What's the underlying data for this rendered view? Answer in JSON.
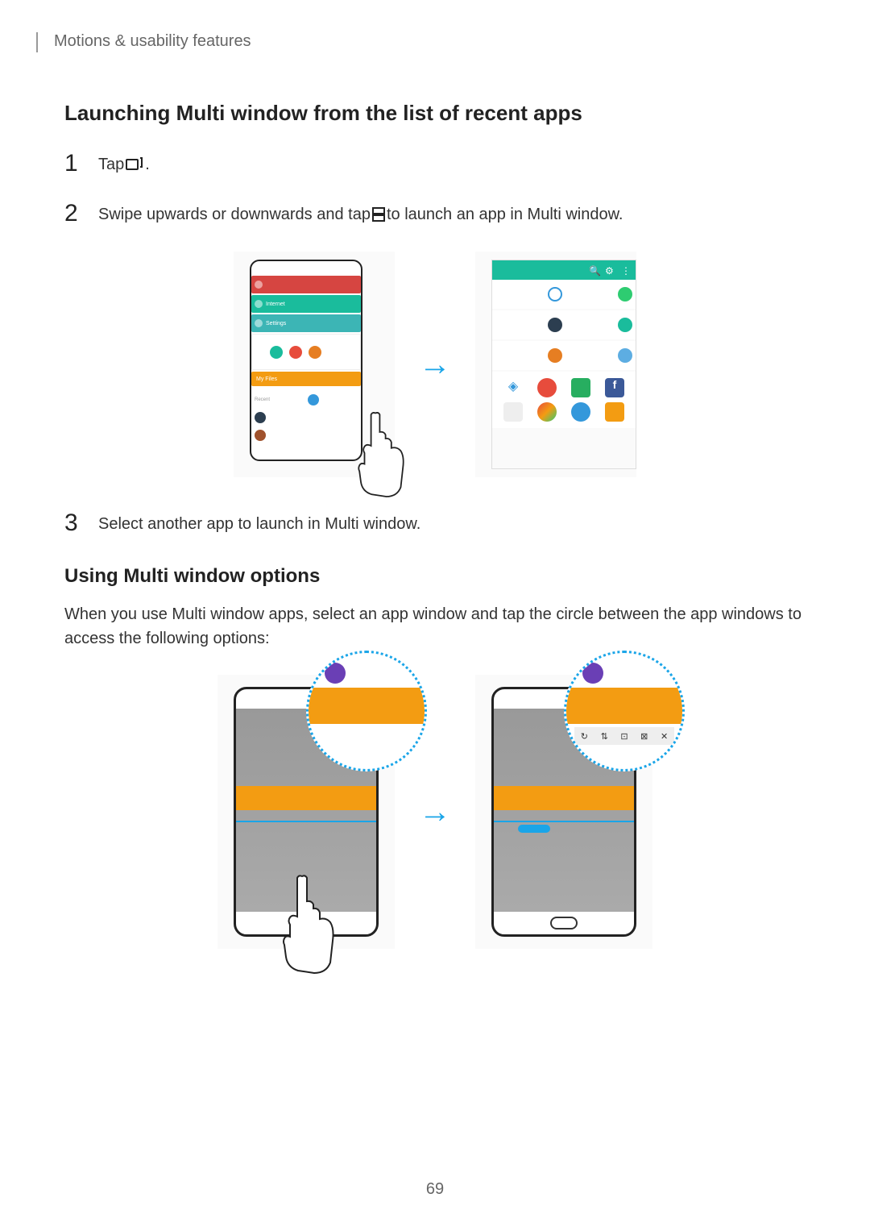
{
  "header": "Motions & usability features",
  "section1": {
    "heading": "Launching Multi window from the list of recent apps",
    "step1_num": "1",
    "step1_text_a": "Tap ",
    "step1_text_b": ".",
    "step2_num": "2",
    "step2_text_a": "Swipe upwards or downwards and tap ",
    "step2_text_b": " to launch an app in Multi window.",
    "step3_num": "3",
    "step3_text": "Select another app to launch in Multi window."
  },
  "section2": {
    "heading": "Using Multi window options",
    "body": "When you use Multi window apps, select an app window and tap the circle between the app windows to access the following options:"
  },
  "page_number": "69"
}
